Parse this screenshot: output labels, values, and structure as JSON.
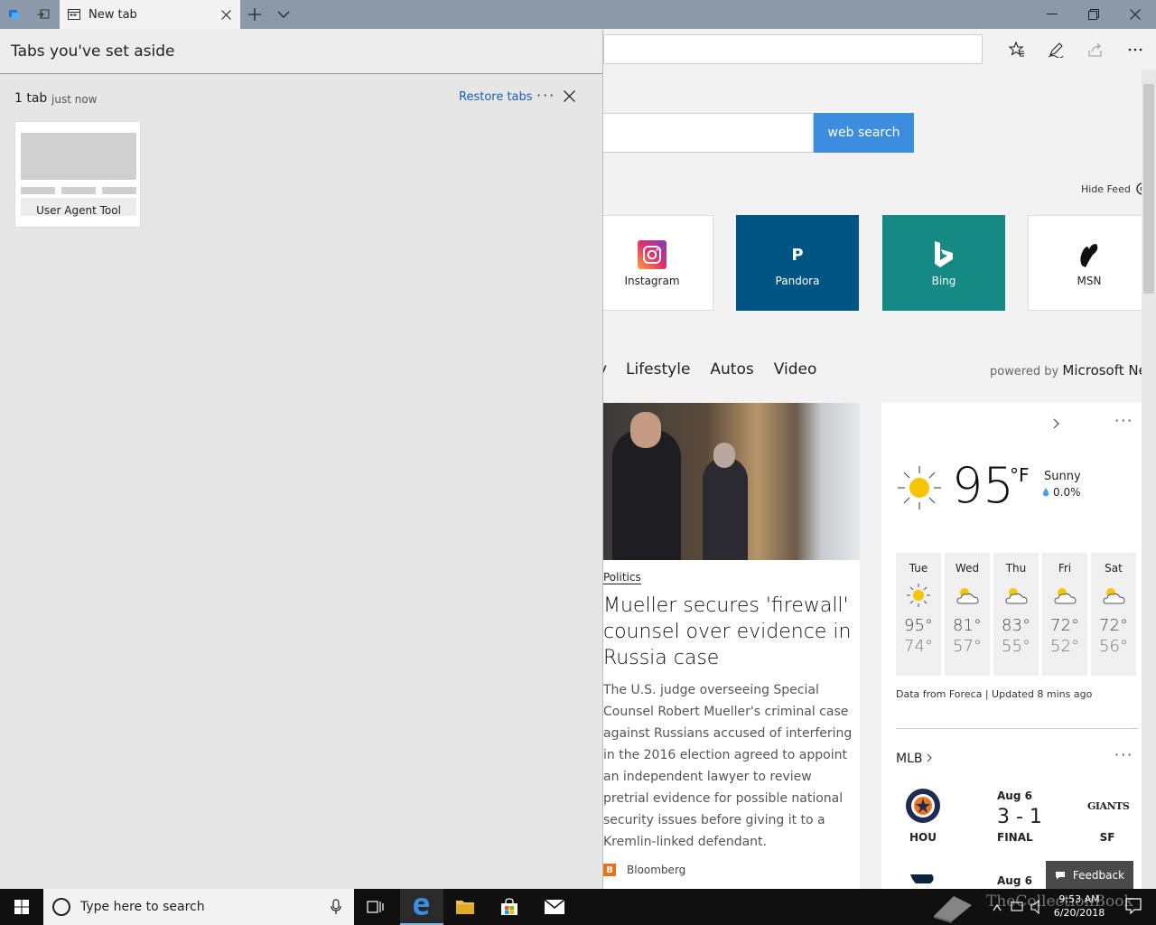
{
  "browser": {
    "tab_title": "New tab"
  },
  "panel": {
    "title": "Tabs you've set aside",
    "group_count": "1 tab",
    "group_time": "just now",
    "restore_label": "Restore tabs",
    "more_label": "···",
    "thumb_label": "User Agent Tool"
  },
  "ntp": {
    "search_button": "web search",
    "hide_feed": "Hide Feed",
    "tiles": [
      {
        "label": "Instagram",
        "icon": "instagram-icon",
        "bg": "#ffffff",
        "fg": "#222222"
      },
      {
        "label": "Pandora",
        "icon": "pandora-icon",
        "bg": "#005483",
        "fg": "#ffffff",
        "glyph": "P"
      },
      {
        "label": "Bing",
        "icon": "bing-icon",
        "bg": "#138a83",
        "fg": "#ffffff"
      },
      {
        "label": "MSN",
        "icon": "msn-icon",
        "bg": "#ffffff",
        "fg": "#222222"
      }
    ],
    "categories": [
      "Lifestyle",
      "Autos",
      "Video"
    ],
    "powered_prefix": "powered by",
    "powered_brand": "Microsoft New",
    "news": {
      "category": "Politics",
      "title": "Mueller secures 'firewall' counsel over evidence in Russia case",
      "body": "The U.S. judge overseeing Special Counsel Robert Mueller's criminal case against Russians accused of interfering in the 2016 election agreed to appoint an independent lawyer to review pretrial evidence for possible national security issues before giving it to a Kremlin-linked defendant.",
      "source": "Bloomberg",
      "source_glyph": "B"
    },
    "weather": {
      "temp": "95",
      "unit": "°F",
      "condition": "Sunny",
      "precip": "0.0%",
      "days": [
        {
          "name": "Tue",
          "hi": "95°",
          "lo": "74°",
          "icon": "sun"
        },
        {
          "name": "Wed",
          "hi": "81°",
          "lo": "57°",
          "icon": "partly-cloudy"
        },
        {
          "name": "Thu",
          "hi": "83°",
          "lo": "55°",
          "icon": "partly-cloudy"
        },
        {
          "name": "Fri",
          "hi": "72°",
          "lo": "52°",
          "icon": "partly-cloudy"
        },
        {
          "name": "Sat",
          "hi": "72°",
          "lo": "56°",
          "icon": "partly-cloudy"
        }
      ],
      "footer": "Data from Foreca | Updated 8 mins ago"
    },
    "mlb": {
      "label": "MLB",
      "home": "HOU",
      "away": "SF",
      "away_logo": "GIANTS",
      "date": "Aug 6",
      "score": "3 - 1",
      "status": "FINAL",
      "date2": "Aug 6"
    },
    "feedback": "Feedback"
  },
  "taskbar": {
    "search_placeholder": "Type here to search",
    "time": "9:53 AM",
    "date": "6/20/2018",
    "watermark": "TheCollectionBook"
  },
  "colors": {
    "accent": "#3c8de0",
    "titlebar": "#8c99a8",
    "link": "#1a5fb4"
  }
}
